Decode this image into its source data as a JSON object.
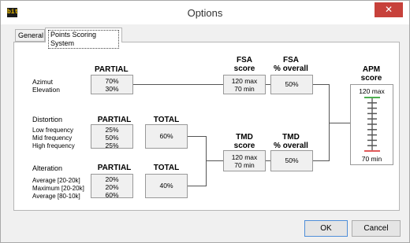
{
  "window": {
    "title": "Options",
    "logo_text": "bit",
    "close_glyph": "✕"
  },
  "tabs": [
    {
      "label": "General"
    },
    {
      "label": "Points Scoring System"
    }
  ],
  "azimut": {
    "header": "PARTIAL",
    "labels": "Azimut\nElevation",
    "values": "70%\n30%"
  },
  "fsa": {
    "score_header": "FSA\nscore",
    "score_value": "120 max\n70 min",
    "overall_header": "FSA\n% overall",
    "overall_value": "50%"
  },
  "distortion": {
    "title": "Distortion",
    "partial_header": "PARTIAL",
    "total_header": "TOTAL",
    "labels": "Low frequency\nMid frequency\nHigh frequency",
    "values": "25%\n50%\n25%",
    "total_value": "60%"
  },
  "alteration": {
    "title": "Alteration",
    "partial_header": "PARTIAL",
    "total_header": "TOTAL",
    "labels": "Average [20-20k]\nMaximum [20-20k]\nAverage [80-10k]",
    "values": "20%\n20%\n60%",
    "total_value": "40%"
  },
  "tmd": {
    "score_header": "TMD\nscore",
    "score_value": "120 max\n70 min",
    "overall_header": "TMD\n% overall",
    "overall_value": "50%"
  },
  "apm": {
    "header": "APM\nscore",
    "max_label": "120 max",
    "min_label": "70 min",
    "max_color": "#4caf50",
    "min_color": "#e05a5a"
  },
  "buttons": {
    "ok": "OK",
    "cancel": "Cancel"
  }
}
